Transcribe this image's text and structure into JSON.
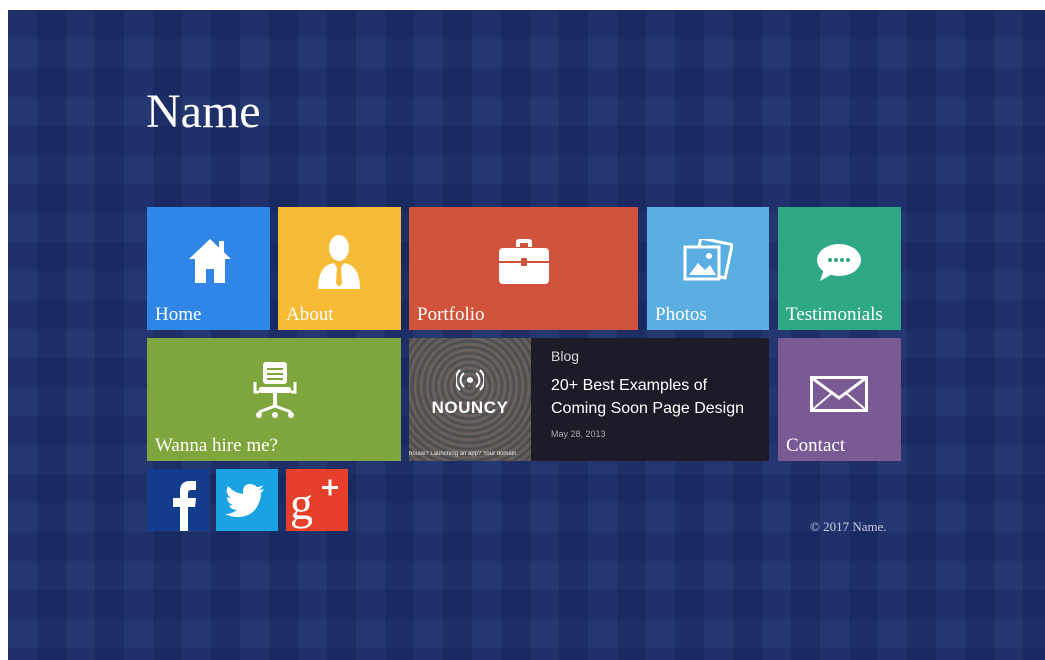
{
  "site": {
    "name": "Name"
  },
  "tiles": {
    "home": {
      "label": "Home",
      "color": "#2f86e6",
      "icon": "house-icon"
    },
    "about": {
      "label": "About",
      "color": "#f7ba35",
      "icon": "person-icon"
    },
    "portfolio": {
      "label": "Portfolio",
      "color": "#d0523a",
      "icon": "briefcase-icon"
    },
    "photos": {
      "label": "Photos",
      "color": "#5aaee2",
      "icon": "photos-icon"
    },
    "testimonials": {
      "label": "Testimonials",
      "color": "#2fa886",
      "icon": "chat-bubble-icon"
    },
    "hire": {
      "label": "Wanna hire me?",
      "color": "#7ea63d",
      "icon": "office-chair-icon"
    },
    "contact": {
      "label": "Contact",
      "color": "#7a5a94",
      "icon": "envelope-icon"
    }
  },
  "blog": {
    "category": "Blog",
    "title": "20+ Best Examples of Coming Soon Page Design",
    "date": "May 28, 2013",
    "thumb_brand": "NOUNCY",
    "thumb_caption": "house? Launching an app? Your domain"
  },
  "social": [
    {
      "name": "facebook",
      "icon": "facebook-icon",
      "color": "#133c8c"
    },
    {
      "name": "twitter",
      "icon": "twitter-icon",
      "color": "#1aa3e2"
    },
    {
      "name": "google-plus",
      "icon": "google-plus-icon",
      "color": "#e6402a"
    }
  ],
  "footer": {
    "copyright": "© 2017 Name."
  }
}
